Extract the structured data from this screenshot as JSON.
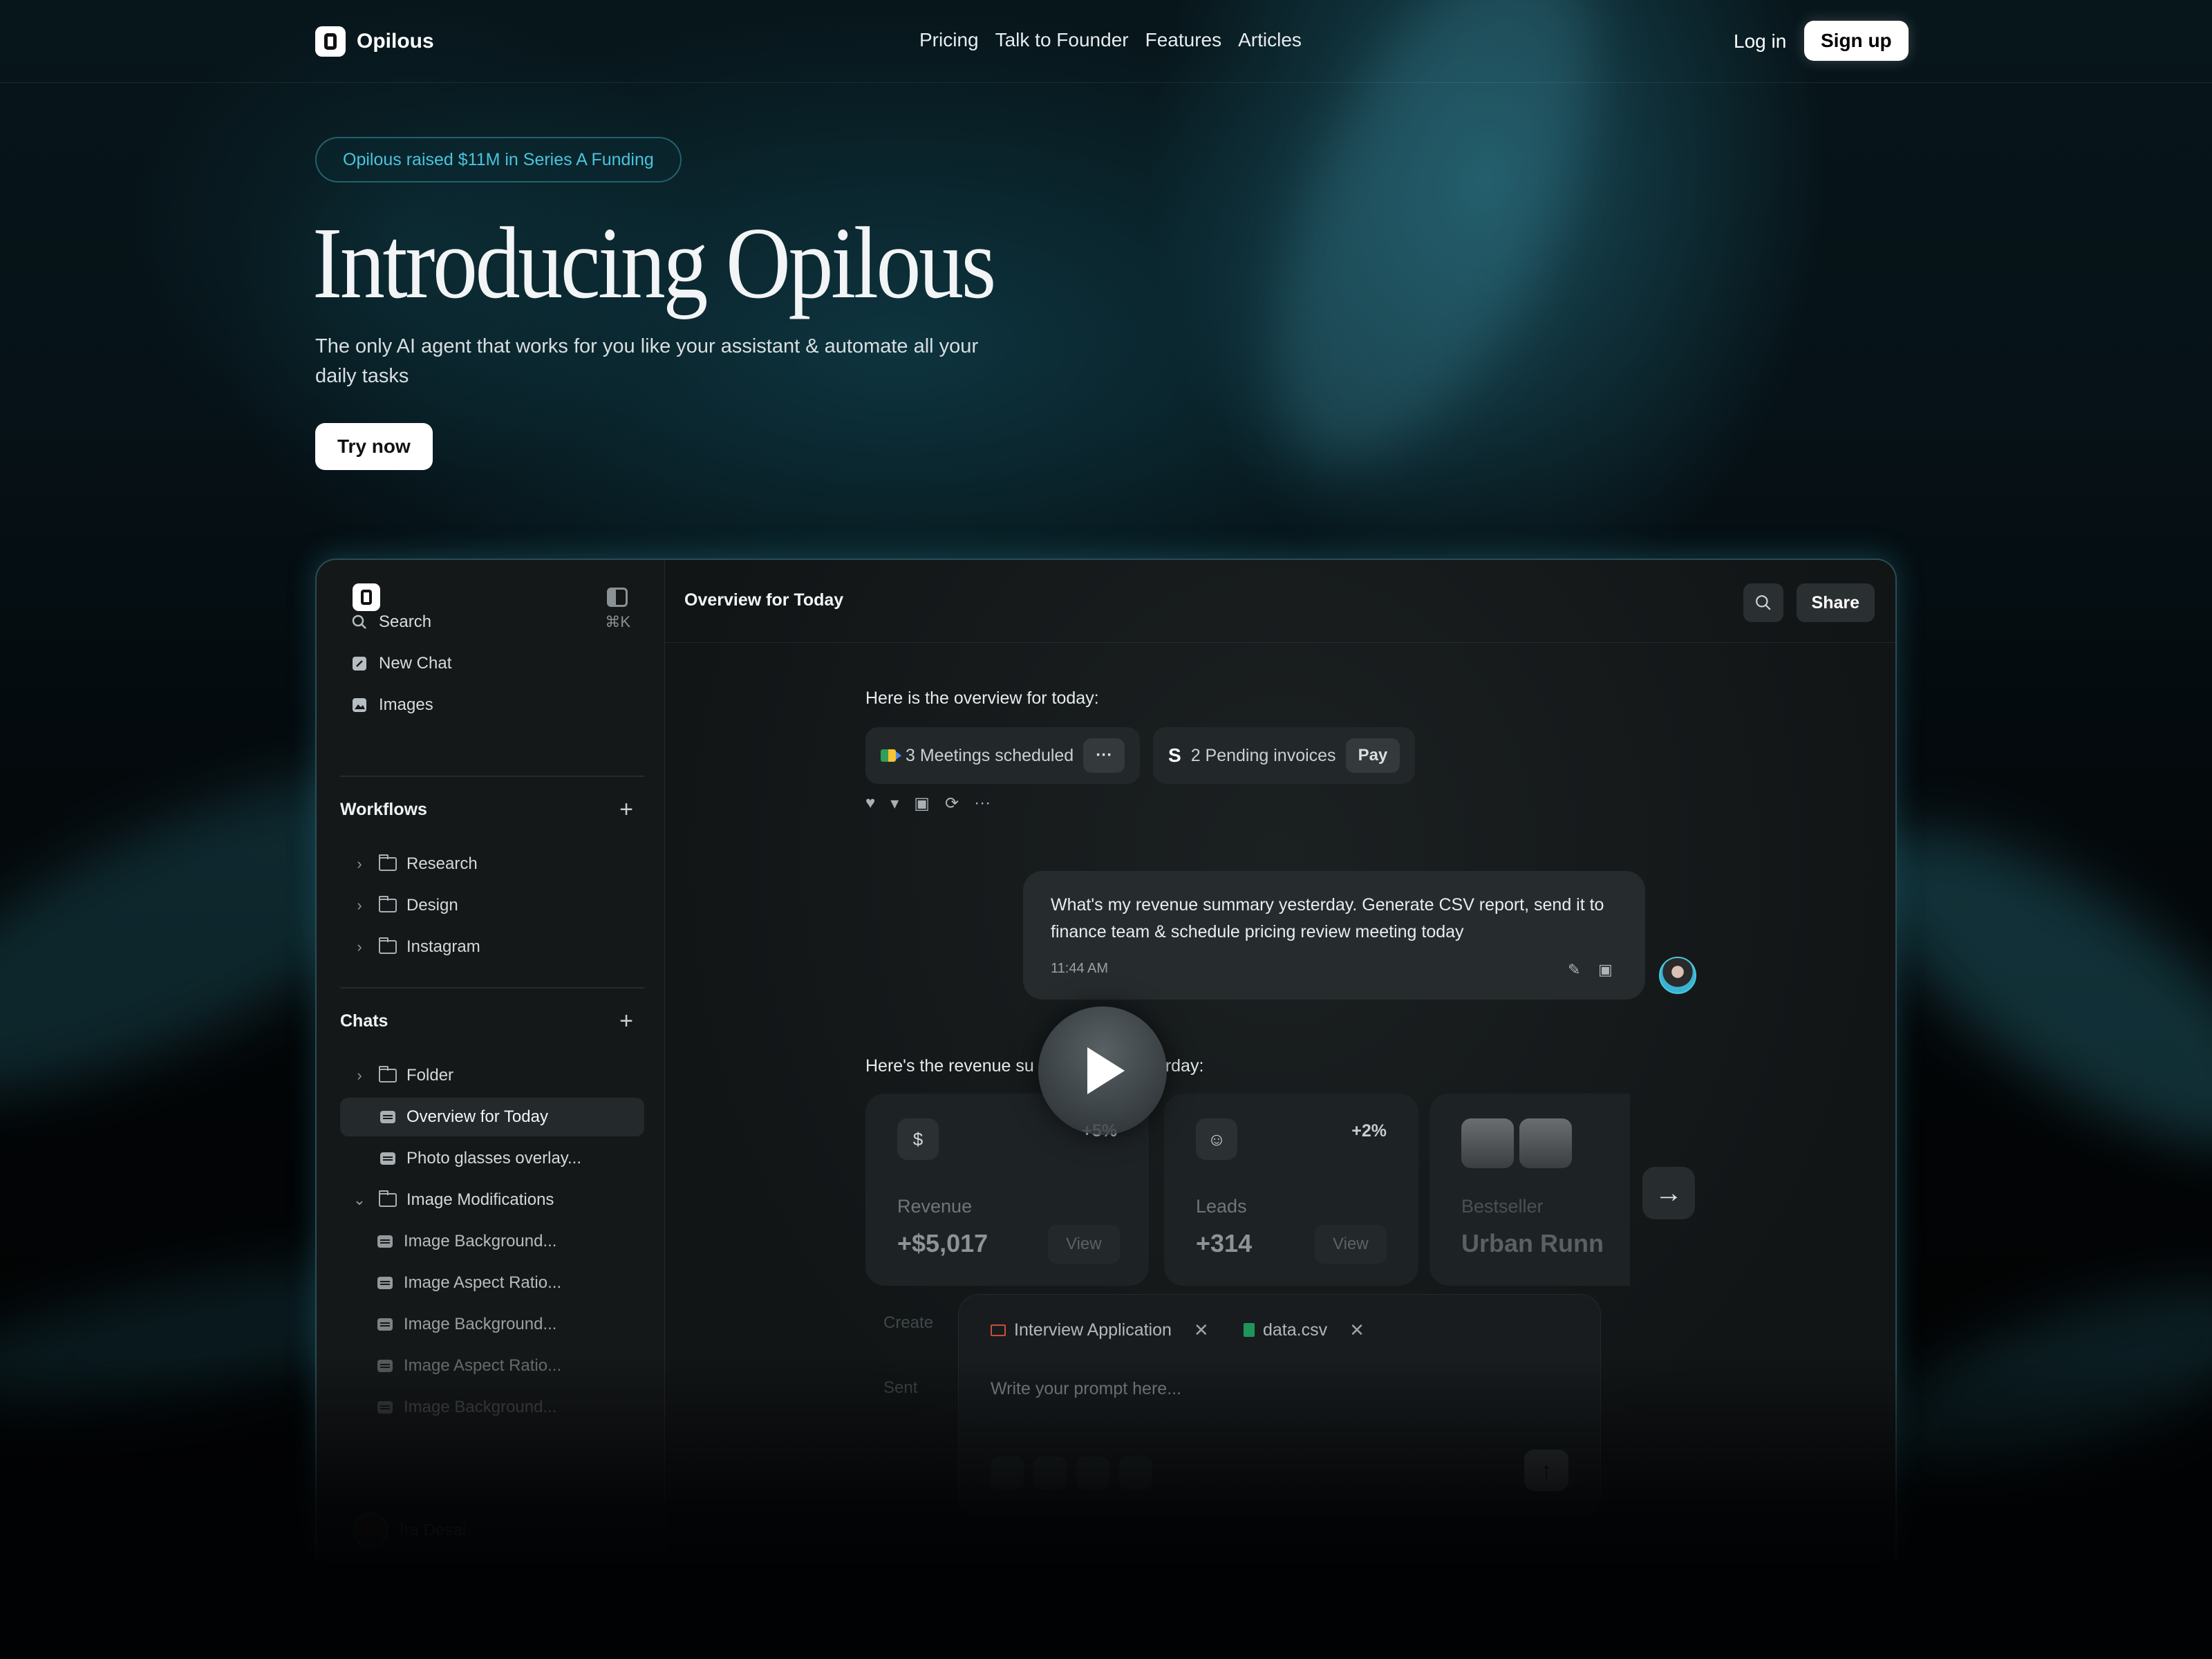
{
  "nav": {
    "brand": "Opilous",
    "links": [
      "Pricing",
      "Talk to Founder",
      "Features",
      "Articles"
    ],
    "login": "Log in",
    "signup": "Sign up"
  },
  "hero": {
    "badge": "Opilous raised $11M in Series A Funding",
    "title": "Introducing Opilous",
    "subtitle": "The only AI agent that works for you like your assistant & automate all your daily tasks",
    "cta": "Try now"
  },
  "app": {
    "sidebar": {
      "search": "Search",
      "search_shortcut": "⌘K",
      "new_chat": "New Chat",
      "images": "Images",
      "workflows_title": "Workflows",
      "workflows": [
        "Research",
        "Design",
        "Instagram"
      ],
      "chats_title": "Chats",
      "chats": {
        "folder": "Folder",
        "active": "Overview for Today",
        "photo": "Photo glasses overlay...",
        "image_mods": "Image Modifications",
        "sub": [
          "Image Background...",
          "Image Aspect Ratio...",
          "Image Background...",
          "Image Aspect Ratio...",
          "Image Background..."
        ]
      },
      "user_name": "Ira Desai"
    },
    "header": {
      "title": "Overview for Today",
      "share": "Share"
    },
    "conversation": {
      "intro": "Here is the overview for today:",
      "meetings": "3 Meetings scheduled",
      "invoices": "2 Pending invoices",
      "pay": "Pay",
      "user_message": "What's my revenue summary yesterday. Generate CSV report, send it to finance team & schedule pricing review meeting today",
      "time": "11:44 AM",
      "revenue_intro_left": "Here's the revenue su",
      "revenue_intro_right": "rday:",
      "cards": [
        {
          "pct": "+5%",
          "label": "Revenue",
          "value": "+$5,017",
          "view": "View"
        },
        {
          "pct": "+2%",
          "label": "Leads",
          "value": "+314",
          "view": "View"
        },
        {
          "label": "Bestseller",
          "value": "Urban Runn"
        }
      ]
    },
    "composer": {
      "chip1": "Interview Application",
      "chip2": "data.csv",
      "placeholder": "Write your prompt here...",
      "ghost_create": "Create",
      "ghost_send": "Sent"
    }
  }
}
